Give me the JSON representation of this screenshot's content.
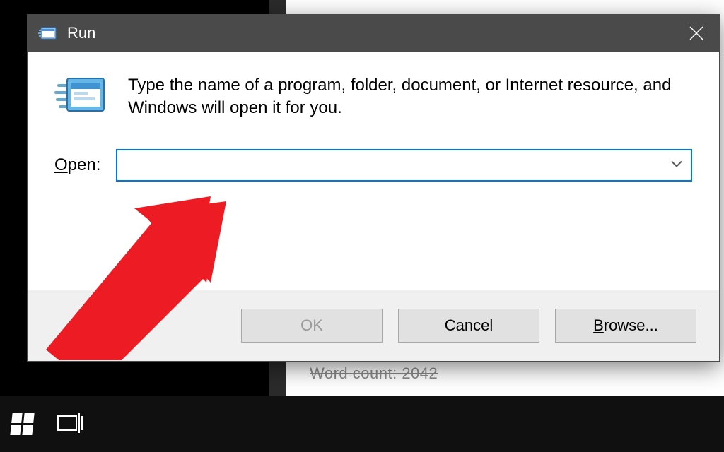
{
  "dialog": {
    "title": "Run",
    "description": "Type the name of a program, folder, document, or Internet resource, and Windows will open it for you.",
    "open_label_prefix": "O",
    "open_label_rest": "pen:",
    "input_value": "",
    "buttons": {
      "ok": "OK",
      "cancel": "Cancel",
      "browse_prefix": "B",
      "browse_rest": "rowse..."
    }
  },
  "background": {
    "word_count_text": "Word count: 2042"
  },
  "colors": {
    "titlebar": "#4a4a4a",
    "focus_border": "#0078d7",
    "button_face": "#e1e1e1",
    "button_row_bg": "#f0f0f0",
    "arrow": "#ed1c24"
  }
}
